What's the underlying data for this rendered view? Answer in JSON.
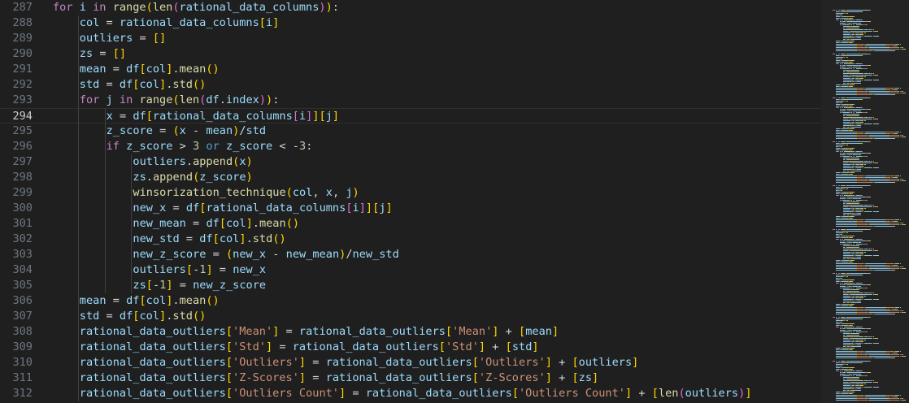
{
  "editor": {
    "current_line": "294",
    "lines": [
      {
        "number": "287",
        "indent": 1,
        "tokens": [
          [
            "kw",
            "for"
          ],
          [
            "op",
            " "
          ],
          [
            "var",
            "i"
          ],
          [
            "op",
            " "
          ],
          [
            "kw",
            "in"
          ],
          [
            "op",
            " "
          ],
          [
            "fn",
            "range"
          ],
          [
            "b1",
            "("
          ],
          [
            "fn",
            "len"
          ],
          [
            "b2",
            "("
          ],
          [
            "var",
            "rational_data_columns"
          ],
          [
            "b2",
            ")"
          ],
          [
            "b1",
            ")"
          ],
          [
            "op",
            ":"
          ]
        ]
      },
      {
        "number": "288",
        "indent": 2,
        "tokens": [
          [
            "var",
            "col"
          ],
          [
            "op",
            " = "
          ],
          [
            "var",
            "rational_data_columns"
          ],
          [
            "b1",
            "["
          ],
          [
            "var",
            "i"
          ],
          [
            "b1",
            "]"
          ]
        ]
      },
      {
        "number": "289",
        "indent": 2,
        "tokens": [
          [
            "var",
            "outliers"
          ],
          [
            "op",
            " = "
          ],
          [
            "b1",
            "[]"
          ]
        ]
      },
      {
        "number": "290",
        "indent": 2,
        "tokens": [
          [
            "var",
            "zs"
          ],
          [
            "op",
            " = "
          ],
          [
            "b1",
            "[]"
          ]
        ]
      },
      {
        "number": "291",
        "indent": 2,
        "tokens": [
          [
            "var",
            "mean"
          ],
          [
            "op",
            " = "
          ],
          [
            "var",
            "df"
          ],
          [
            "b1",
            "["
          ],
          [
            "var",
            "col"
          ],
          [
            "b1",
            "]"
          ],
          [
            "op",
            "."
          ],
          [
            "fn",
            "mean"
          ],
          [
            "b1",
            "()"
          ]
        ]
      },
      {
        "number": "292",
        "indent": 2,
        "tokens": [
          [
            "var",
            "std"
          ],
          [
            "op",
            " = "
          ],
          [
            "var",
            "df"
          ],
          [
            "b1",
            "["
          ],
          [
            "var",
            "col"
          ],
          [
            "b1",
            "]"
          ],
          [
            "op",
            "."
          ],
          [
            "fn",
            "std"
          ],
          [
            "b1",
            "()"
          ]
        ]
      },
      {
        "number": "293",
        "indent": 2,
        "tokens": [
          [
            "kw",
            "for"
          ],
          [
            "op",
            " "
          ],
          [
            "var",
            "j"
          ],
          [
            "op",
            " "
          ],
          [
            "kw",
            "in"
          ],
          [
            "op",
            " "
          ],
          [
            "fn",
            "range"
          ],
          [
            "b1",
            "("
          ],
          [
            "fn",
            "len"
          ],
          [
            "b2",
            "("
          ],
          [
            "var",
            "df"
          ],
          [
            "op",
            "."
          ],
          [
            "var",
            "index"
          ],
          [
            "b2",
            ")"
          ],
          [
            "b1",
            ")"
          ],
          [
            "op",
            ":"
          ]
        ]
      },
      {
        "number": "294",
        "indent": 3,
        "tokens": [
          [
            "var",
            "x"
          ],
          [
            "op",
            " = "
          ],
          [
            "var",
            "df"
          ],
          [
            "b1",
            "["
          ],
          [
            "var",
            "rational_data_columns"
          ],
          [
            "b2",
            "["
          ],
          [
            "var",
            "i"
          ],
          [
            "b2",
            "]"
          ],
          [
            "b1",
            "]"
          ],
          [
            "b1",
            "["
          ],
          [
            "var",
            "j"
          ],
          [
            "b1",
            "]"
          ]
        ]
      },
      {
        "number": "295",
        "indent": 3,
        "tokens": [
          [
            "var",
            "z_score"
          ],
          [
            "op",
            " = "
          ],
          [
            "b1",
            "("
          ],
          [
            "var",
            "x"
          ],
          [
            "op",
            " - "
          ],
          [
            "var",
            "mean"
          ],
          [
            "b1",
            ")"
          ],
          [
            "op",
            "/"
          ],
          [
            "var",
            "std"
          ]
        ]
      },
      {
        "number": "296",
        "indent": 3,
        "tokens": [
          [
            "kw",
            "if"
          ],
          [
            "op",
            " "
          ],
          [
            "var",
            "z_score"
          ],
          [
            "op",
            " > "
          ],
          [
            "num",
            "3"
          ],
          [
            "op",
            " "
          ],
          [
            "lit",
            "or"
          ],
          [
            "op",
            " "
          ],
          [
            "var",
            "z_score"
          ],
          [
            "op",
            " < -"
          ],
          [
            "num",
            "3"
          ],
          [
            "op",
            ":"
          ]
        ]
      },
      {
        "number": "297",
        "indent": 4,
        "tokens": [
          [
            "var",
            "outliers"
          ],
          [
            "op",
            "."
          ],
          [
            "fn",
            "append"
          ],
          [
            "b1",
            "("
          ],
          [
            "var",
            "x"
          ],
          [
            "b1",
            ")"
          ]
        ]
      },
      {
        "number": "298",
        "indent": 4,
        "tokens": [
          [
            "var",
            "zs"
          ],
          [
            "op",
            "."
          ],
          [
            "fn",
            "append"
          ],
          [
            "b1",
            "("
          ],
          [
            "var",
            "z_score"
          ],
          [
            "b1",
            ")"
          ]
        ]
      },
      {
        "number": "299",
        "indent": 4,
        "tokens": [
          [
            "fn",
            "winsorization_technique"
          ],
          [
            "b1",
            "("
          ],
          [
            "var",
            "col"
          ],
          [
            "op",
            ", "
          ],
          [
            "var",
            "x"
          ],
          [
            "op",
            ", "
          ],
          [
            "var",
            "j"
          ],
          [
            "b1",
            ")"
          ]
        ]
      },
      {
        "number": "300",
        "indent": 4,
        "tokens": [
          [
            "var",
            "new_x"
          ],
          [
            "op",
            " = "
          ],
          [
            "var",
            "df"
          ],
          [
            "b1",
            "["
          ],
          [
            "var",
            "rational_data_columns"
          ],
          [
            "b2",
            "["
          ],
          [
            "var",
            "i"
          ],
          [
            "b2",
            "]"
          ],
          [
            "b1",
            "]"
          ],
          [
            "b1",
            "["
          ],
          [
            "var",
            "j"
          ],
          [
            "b1",
            "]"
          ]
        ]
      },
      {
        "number": "301",
        "indent": 4,
        "tokens": [
          [
            "var",
            "new_mean"
          ],
          [
            "op",
            " = "
          ],
          [
            "var",
            "df"
          ],
          [
            "b1",
            "["
          ],
          [
            "var",
            "col"
          ],
          [
            "b1",
            "]"
          ],
          [
            "op",
            "."
          ],
          [
            "fn",
            "mean"
          ],
          [
            "b1",
            "()"
          ]
        ]
      },
      {
        "number": "302",
        "indent": 4,
        "tokens": [
          [
            "var",
            "new_std"
          ],
          [
            "op",
            " = "
          ],
          [
            "var",
            "df"
          ],
          [
            "b1",
            "["
          ],
          [
            "var",
            "col"
          ],
          [
            "b1",
            "]"
          ],
          [
            "op",
            "."
          ],
          [
            "fn",
            "std"
          ],
          [
            "b1",
            "()"
          ]
        ]
      },
      {
        "number": "303",
        "indent": 4,
        "tokens": [
          [
            "var",
            "new_z_score"
          ],
          [
            "op",
            " = "
          ],
          [
            "b1",
            "("
          ],
          [
            "var",
            "new_x"
          ],
          [
            "op",
            " - "
          ],
          [
            "var",
            "new_mean"
          ],
          [
            "b1",
            ")"
          ],
          [
            "op",
            "/"
          ],
          [
            "var",
            "new_std"
          ]
        ]
      },
      {
        "number": "304",
        "indent": 4,
        "tokens": [
          [
            "var",
            "outliers"
          ],
          [
            "b1",
            "["
          ],
          [
            "op",
            "-"
          ],
          [
            "num",
            "1"
          ],
          [
            "b1",
            "]"
          ],
          [
            "op",
            " = "
          ],
          [
            "var",
            "new_x"
          ]
        ]
      },
      {
        "number": "305",
        "indent": 4,
        "tokens": [
          [
            "var",
            "zs"
          ],
          [
            "b1",
            "["
          ],
          [
            "op",
            "-"
          ],
          [
            "num",
            "1"
          ],
          [
            "b1",
            "]"
          ],
          [
            "op",
            " = "
          ],
          [
            "var",
            "new_z_score"
          ]
        ]
      },
      {
        "number": "306",
        "indent": 2,
        "tokens": [
          [
            "var",
            "mean"
          ],
          [
            "op",
            " = "
          ],
          [
            "var",
            "df"
          ],
          [
            "b1",
            "["
          ],
          [
            "var",
            "col"
          ],
          [
            "b1",
            "]"
          ],
          [
            "op",
            "."
          ],
          [
            "fn",
            "mean"
          ],
          [
            "b1",
            "()"
          ]
        ]
      },
      {
        "number": "307",
        "indent": 2,
        "tokens": [
          [
            "var",
            "std"
          ],
          [
            "op",
            " = "
          ],
          [
            "var",
            "df"
          ],
          [
            "b1",
            "["
          ],
          [
            "var",
            "col"
          ],
          [
            "b1",
            "]"
          ],
          [
            "op",
            "."
          ],
          [
            "fn",
            "std"
          ],
          [
            "b1",
            "()"
          ]
        ]
      },
      {
        "number": "308",
        "indent": 2,
        "tokens": [
          [
            "var",
            "rational_data_outliers"
          ],
          [
            "b1",
            "["
          ],
          [
            "str",
            "'Mean'"
          ],
          [
            "b1",
            "]"
          ],
          [
            "op",
            " = "
          ],
          [
            "var",
            "rational_data_outliers"
          ],
          [
            "b1",
            "["
          ],
          [
            "str",
            "'Mean'"
          ],
          [
            "b1",
            "]"
          ],
          [
            "op",
            " + "
          ],
          [
            "b1",
            "["
          ],
          [
            "var",
            "mean"
          ],
          [
            "b1",
            "]"
          ]
        ]
      },
      {
        "number": "309",
        "indent": 2,
        "tokens": [
          [
            "var",
            "rational_data_outliers"
          ],
          [
            "b1",
            "["
          ],
          [
            "str",
            "'Std'"
          ],
          [
            "b1",
            "]"
          ],
          [
            "op",
            " = "
          ],
          [
            "var",
            "rational_data_outliers"
          ],
          [
            "b1",
            "["
          ],
          [
            "str",
            "'Std'"
          ],
          [
            "b1",
            "]"
          ],
          [
            "op",
            " + "
          ],
          [
            "b1",
            "["
          ],
          [
            "var",
            "std"
          ],
          [
            "b1",
            "]"
          ]
        ]
      },
      {
        "number": "310",
        "indent": 2,
        "tokens": [
          [
            "var",
            "rational_data_outliers"
          ],
          [
            "b1",
            "["
          ],
          [
            "str",
            "'Outliers'"
          ],
          [
            "b1",
            "]"
          ],
          [
            "op",
            " = "
          ],
          [
            "var",
            "rational_data_outliers"
          ],
          [
            "b1",
            "["
          ],
          [
            "str",
            "'Outliers'"
          ],
          [
            "b1",
            "]"
          ],
          [
            "op",
            " + "
          ],
          [
            "b1",
            "["
          ],
          [
            "var",
            "outliers"
          ],
          [
            "b1",
            "]"
          ]
        ]
      },
      {
        "number": "311",
        "indent": 2,
        "tokens": [
          [
            "var",
            "rational_data_outliers"
          ],
          [
            "b1",
            "["
          ],
          [
            "str",
            "'Z-Scores'"
          ],
          [
            "b1",
            "]"
          ],
          [
            "op",
            " = "
          ],
          [
            "var",
            "rational_data_outliers"
          ],
          [
            "b1",
            "["
          ],
          [
            "str",
            "'Z-Scores'"
          ],
          [
            "b1",
            "]"
          ],
          [
            "op",
            " + "
          ],
          [
            "b1",
            "["
          ],
          [
            "var",
            "zs"
          ],
          [
            "b1",
            "]"
          ]
        ]
      },
      {
        "number": "312",
        "indent": 2,
        "tokens": [
          [
            "var",
            "rational_data_outliers"
          ],
          [
            "b1",
            "["
          ],
          [
            "str",
            "'Outliers Count'"
          ],
          [
            "b1",
            "]"
          ],
          [
            "op",
            " = "
          ],
          [
            "var",
            "rational_data_outliers"
          ],
          [
            "b1",
            "["
          ],
          [
            "str",
            "'Outliers Count'"
          ],
          [
            "b1",
            "]"
          ],
          [
            "op",
            " + "
          ],
          [
            "b1",
            "["
          ],
          [
            "fn",
            "len"
          ],
          [
            "b2",
            "("
          ],
          [
            "var",
            "outliers"
          ],
          [
            "b2",
            ")"
          ],
          [
            "b1",
            "]"
          ]
        ]
      }
    ]
  },
  "colors": {
    "background": "#1f1f1f",
    "keyword": "#c586c0",
    "function": "#dcdcaa",
    "variable": "#9cdcfe",
    "string": "#ce9178",
    "number": "#b5cea8",
    "bracket_level_1": "#ffd700",
    "bracket_level_2": "#da70d6"
  }
}
